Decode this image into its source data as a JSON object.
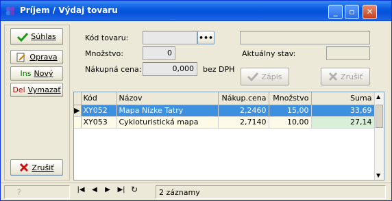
{
  "window": {
    "title": "Príjem / Výdaj tovaru"
  },
  "left": {
    "suhlas": "Súhlas",
    "oprava": "Oprava",
    "novy_prefix": "Ins",
    "novy": "Nový",
    "vymazat_prefix": "Del",
    "vymazat": "Vymazať",
    "zrusit": "Zrušiť"
  },
  "form": {
    "kod_label": "Kód tovaru:",
    "kod_value": "",
    "mnozstvo_label": "Množstvo:",
    "mnozstvo_value": "0",
    "cena_label": "Nákupná cena:",
    "cena_value": "0,000",
    "cena_unit": "bez DPH",
    "aktualny_label": "Aktuálny stav:",
    "aktualny_value": "",
    "zapis": "Zápis",
    "zrusit": "Zrušiť",
    "browse": "•••"
  },
  "grid": {
    "headers": [
      "Kód",
      "Názov",
      "Nákup.cena",
      "Množstvo",
      "Suma"
    ],
    "rows": [
      [
        "XY052",
        "Mapa Nízke Tatry",
        "2,2460",
        "15,00",
        "33,69"
      ],
      [
        "XY053",
        "Cykloturistická mapa",
        "2,7140",
        "10,00",
        "27,14"
      ]
    ]
  },
  "status": {
    "help": "?",
    "records": "2 záznamy"
  }
}
